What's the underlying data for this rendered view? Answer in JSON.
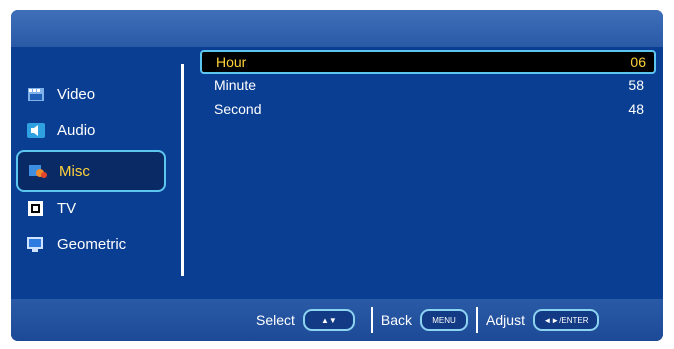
{
  "sidebar": {
    "items": [
      {
        "label": "Video",
        "icon": "video-icon"
      },
      {
        "label": "Audio",
        "icon": "audio-icon"
      },
      {
        "label": "Misc",
        "icon": "misc-icon"
      },
      {
        "label": "TV",
        "icon": "tv-icon"
      },
      {
        "label": "Geometric",
        "icon": "geometric-icon"
      }
    ],
    "active": "Misc"
  },
  "settings": {
    "rows": [
      {
        "label": "Hour",
        "value": "06"
      },
      {
        "label": "Minute",
        "value": "58"
      },
      {
        "label": "Second",
        "value": "48"
      }
    ],
    "active": "Hour"
  },
  "footer": {
    "select_label": "Select",
    "select_key": "▲▼",
    "back_label": "Back",
    "back_key": "MENU",
    "adjust_label": "Adjust",
    "adjust_key": "◄►/ENTER"
  },
  "colors": {
    "panel": "#0a3e92",
    "highlight_border": "#5cc6ef",
    "highlight_text": "#ffd23a"
  }
}
